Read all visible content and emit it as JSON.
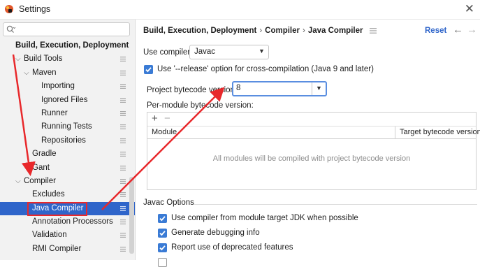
{
  "window": {
    "title": "Settings",
    "close_glyph": "✕"
  },
  "search": {
    "placeholder": ""
  },
  "sidebar": {
    "items": [
      {
        "label": "Build, Execution, Deployment"
      },
      {
        "label": "Build Tools"
      },
      {
        "label": "Maven"
      },
      {
        "label": "Importing"
      },
      {
        "label": "Ignored Files"
      },
      {
        "label": "Runner"
      },
      {
        "label": "Running Tests"
      },
      {
        "label": "Repositories"
      },
      {
        "label": "Gradle"
      },
      {
        "label": "Gant"
      },
      {
        "label": "Compiler"
      },
      {
        "label": "Excludes"
      },
      {
        "label": "Java Compiler",
        "selected": true
      },
      {
        "label": "Annotation Processors"
      },
      {
        "label": "Validation"
      },
      {
        "label": "RMI Compiler"
      }
    ]
  },
  "header": {
    "breadcrumb": [
      "Build, Execution, Deployment",
      "Compiler",
      "Java Compiler"
    ],
    "breadcrumb_sep": "›",
    "reset": "Reset",
    "back": "←",
    "forward": "→"
  },
  "form": {
    "use_compiler_label": "Use compiler:",
    "use_compiler_value": "Javac",
    "release_option_label": "Use '--release' option for cross-compilation (Java 9 and later)",
    "release_option_checked": true,
    "bytecode_label": "Project bytecode version:",
    "bytecode_value": "8",
    "per_module_label": "Per-module bytecode version:"
  },
  "table": {
    "add": "+",
    "remove": "−",
    "columns": [
      "Module",
      "Target bytecode version"
    ],
    "empty_text": "All modules will be compiled with project bytecode version"
  },
  "javac": {
    "section_title": "Javac Options",
    "options": [
      {
        "label": "Use compiler from module target JDK when possible",
        "checked": true
      },
      {
        "label": "Generate debugging info",
        "checked": true
      },
      {
        "label": "Report use of deprecated features",
        "checked": true
      }
    ]
  },
  "colors": {
    "selection": "#2f65ca",
    "link": "#2f65ca",
    "checkbox": "#3a7bd5",
    "annotation": "#e8282b"
  },
  "icons": [
    "app-icon",
    "search-icon",
    "settings-gear-icon",
    "chevron-down-icon",
    "dropdown-arrow-icon",
    "checkmark-icon"
  ]
}
